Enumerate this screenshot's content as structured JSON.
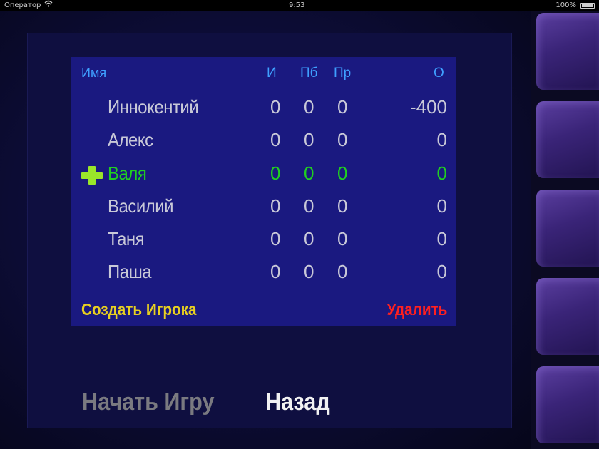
{
  "status_bar": {
    "carrier": "Оператор",
    "time": "9:53",
    "battery": "100%"
  },
  "table": {
    "headers": {
      "name": "Имя",
      "col1": "И",
      "col2": "Пб",
      "col3": "Пр",
      "col4": "О"
    },
    "rows": [
      {
        "name": "Иннокентий",
        "v1": "0",
        "v2": "0",
        "v3": "0",
        "v4": "-400",
        "selected": false
      },
      {
        "name": "Алекс",
        "v1": "0",
        "v2": "0",
        "v3": "0",
        "v4": "0",
        "selected": false
      },
      {
        "name": "Валя",
        "v1": "0",
        "v2": "0",
        "v3": "0",
        "v4": "0",
        "selected": true
      },
      {
        "name": "Василий",
        "v1": "0",
        "v2": "0",
        "v3": "0",
        "v4": "0",
        "selected": false
      },
      {
        "name": "Таня",
        "v1": "0",
        "v2": "0",
        "v3": "0",
        "v4": "0",
        "selected": false
      },
      {
        "name": "Паша",
        "v1": "0",
        "v2": "0",
        "v3": "0",
        "v4": "0",
        "selected": false
      }
    ]
  },
  "actions": {
    "create_player": "Создать Игрока",
    "delete": "Удалить",
    "start_game": "Начать Игру",
    "back": "Назад"
  },
  "icons": {
    "selected_marker": "plus-icon",
    "wifi": "wifi-icon",
    "battery": "battery-icon"
  },
  "colors": {
    "panel": "#1a1980",
    "header_text": "#3fa0ff",
    "row_text": "#c9c9d8",
    "selected_text": "#20d020",
    "create_button": "#e8d020",
    "delete_button": "#ff2020",
    "start_button_disabled": "#7a7a80",
    "back_button": "#f2f2f2"
  }
}
